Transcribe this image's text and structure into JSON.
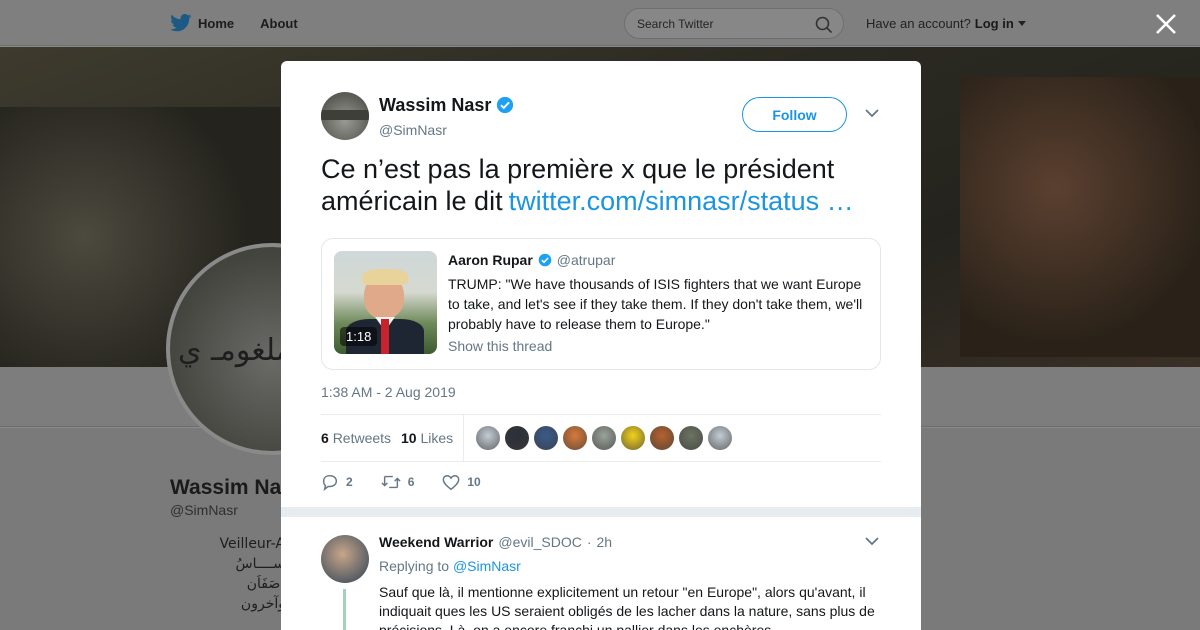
{
  "nav": {
    "home_label": "Home",
    "about_label": "About",
    "search_placeholder": "Search Twitter",
    "account_prompt": "Have an account?",
    "login_label": "Log in"
  },
  "background_profile": {
    "name": "Wassim Na",
    "handle": "@SimNasr",
    "bio_lines": [
      "Veilleur-A",
      "ســــاسُ صَفَاَن:",
      "وآخرون",
      "ً"
    ]
  },
  "tweet": {
    "author_name": "Wassim Nasr",
    "author_handle": "@SimNasr",
    "follow_label": "Follow",
    "text": "Ce n’est pas la première x que le président américain le dit",
    "link_text": "twitter.com/simnasr/status …",
    "timestamp": "1:38 AM - 2 Aug 2019",
    "retweets_count": "6",
    "retweets_label": "Retweets",
    "likes_count": "10",
    "likes_label": "Likes",
    "actions": {
      "replies": "2",
      "retweets": "6",
      "likes": "10"
    }
  },
  "quoted": {
    "name": "Aaron Rupar",
    "handle": "@atrupar",
    "duration": "1:18",
    "text": "TRUMP: \"We have thousands of ISIS fighters that we want Europe to take, and let's see if they take them. If they don't take them, we'll probably have to release them to Europe.\"",
    "show_thread": "Show this thread"
  },
  "likers": [
    {
      "color": "#c3ccd4"
    },
    {
      "color": "#2b2f38"
    },
    {
      "color": "#3a5a8a"
    },
    {
      "color": "#d87a3a"
    },
    {
      "color": "#9aa39a"
    },
    {
      "color": "#f2d21b"
    },
    {
      "color": "#b5622e"
    },
    {
      "color": "#6c7462"
    },
    {
      "color": "#c3ccd4"
    }
  ],
  "reply": {
    "name": "Weekend Warrior",
    "handle": "@evil_SDOC",
    "time": "2h",
    "replying_prefix": "Replying to",
    "replying_to": "@SimNasr",
    "text": "Sauf que là, il mentionne explicitement un retour \"en Europe\", alors qu'avant, il indiquait ques les US seraient obligés de les lacher dans la nature, sans plus de précisions. Là, on a encore franchi un pallier dans les enchères."
  },
  "colors": {
    "accent": "#1b95e0",
    "secondary_text": "#657786",
    "verified": "#1da1f2"
  }
}
